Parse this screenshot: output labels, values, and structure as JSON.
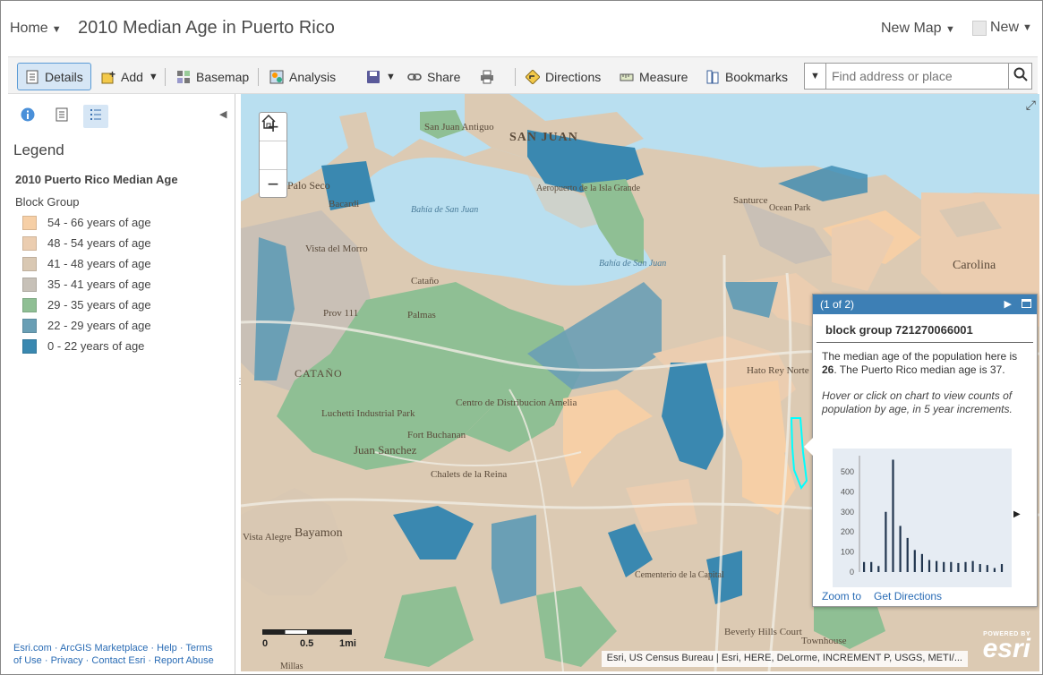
{
  "header": {
    "home_label": "Home",
    "map_title": "2010 Median Age in Puerto Rico",
    "new_map_label": "New Map",
    "user_label": "New"
  },
  "toolbar": {
    "details": "Details",
    "add": "Add",
    "basemap": "Basemap",
    "analysis": "Analysis",
    "share": "Share",
    "directions": "Directions",
    "measure": "Measure",
    "bookmarks": "Bookmarks",
    "search_placeholder": "Find address or place"
  },
  "legend": {
    "heading": "Legend",
    "layer_title": "2010 Puerto Rico Median Age",
    "field_title": "Block Group",
    "items": [
      {
        "label": "54 - 66 years of age",
        "color": "#f6cfa6"
      },
      {
        "label": "48 - 54 years of age",
        "color": "#ebcdb0"
      },
      {
        "label": "41 - 48 years of age",
        "color": "#d9c8b3"
      },
      {
        "label": "35 - 41 years of age",
        "color": "#c7c1b8"
      },
      {
        "label": "29 - 35 years of age",
        "color": "#8fbf94"
      },
      {
        "label": "22 - 29 years of age",
        "color": "#6a9fb5"
      },
      {
        "label": "0 - 22 years of age",
        "color": "#3a88b0"
      }
    ]
  },
  "footer": {
    "line1": "Esri.com · ArcGIS Marketplace · Help · Terms",
    "line2": "of Use · Privacy · Contact Esri · Report Abuse"
  },
  "map": {
    "labels": [
      "SAN JUAN",
      "San Juan Antiguo",
      "Palo Seco",
      "Bacardi",
      "Bahía de San Juan",
      "Bahía de San Juan",
      "Aeropuerto de la Isla Grande",
      "Santurce",
      "Ocean Park",
      "Carolina",
      "Vista del Morro",
      "Cataño",
      "Prov 111",
      "Palmas",
      "CATAÑO",
      "Luchetti Industrial Park",
      "Centro de Distribucion Amelia",
      "Fort Buchanan",
      "Juan Sanchez",
      "Chalets de la Reina",
      "Bayamon",
      "Vista Alegre",
      "Hato Rey Norte",
      "Cementerio de la Capital",
      "Beverly Hills Court",
      "Townhouse",
      "Millas"
    ],
    "scale": {
      "zero": "0",
      "half": "0.5",
      "one": "1mi"
    },
    "attribution": "Esri, US Census Bureau | Esri, HERE, DeLorme, INCREMENT P, USGS, METI/...",
    "esri_powered": "POWERED BY",
    "esri_name": "esri"
  },
  "popup": {
    "counter": "(1 of 2)",
    "title": "block group 721270066001",
    "desc_pre": "The median age of the population here is ",
    "desc_value": "26",
    "desc_post": ". The Puerto Rico median age is 37.",
    "hint": "Hover or click on chart to view counts of population by age, in 5 year increments.",
    "zoom_to": "Zoom to",
    "get_directions": "Get Directions"
  },
  "chart_data": {
    "type": "bar",
    "title": "",
    "xlabel": "",
    "ylabel": "",
    "ylim": [
      0,
      580
    ],
    "yticks": [
      0,
      100,
      200,
      300,
      400,
      500
    ],
    "values": [
      50,
      50,
      30,
      300,
      560,
      230,
      170,
      110,
      90,
      60,
      55,
      50,
      50,
      45,
      50,
      55,
      40,
      35,
      20,
      40
    ]
  }
}
